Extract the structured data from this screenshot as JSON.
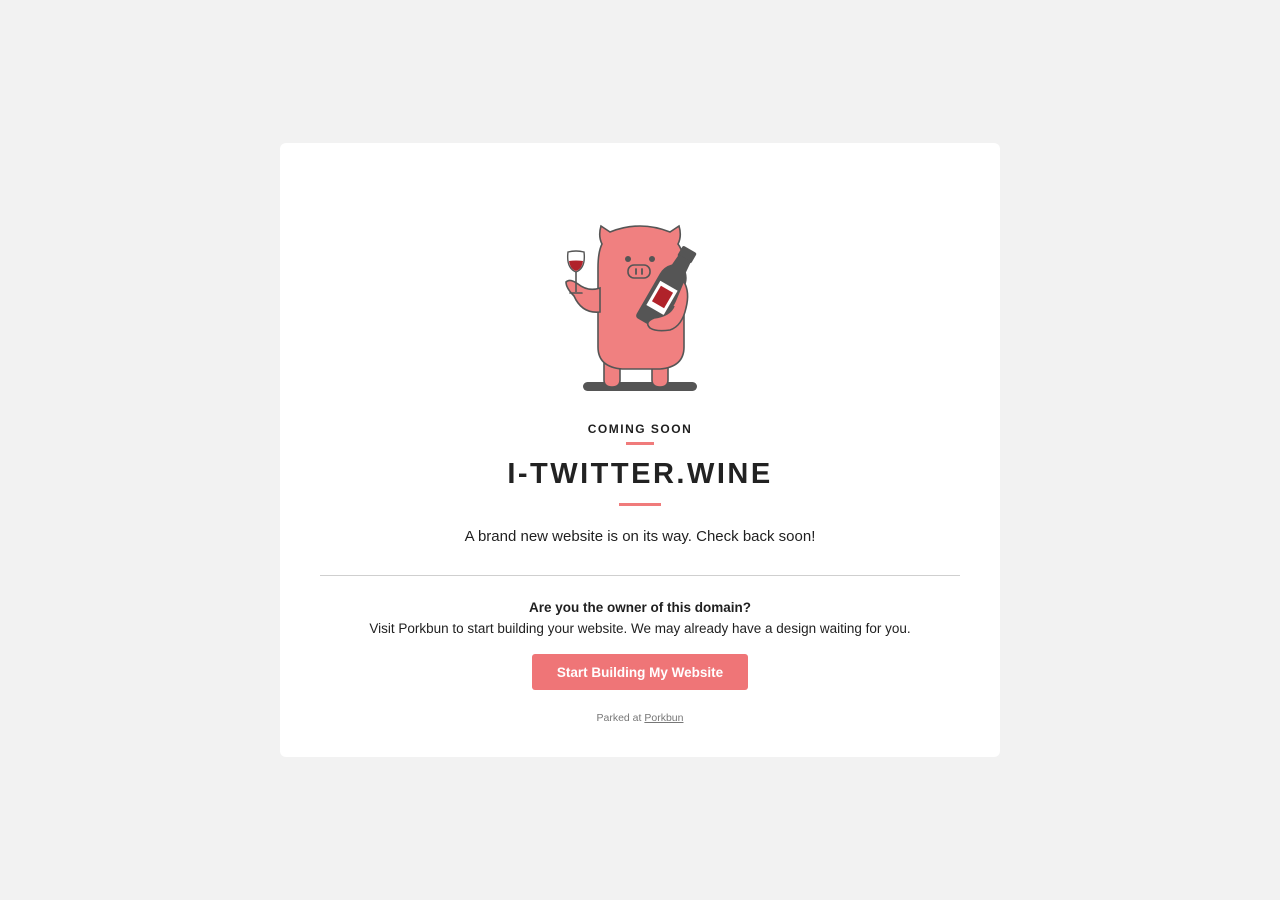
{
  "page": {
    "eyebrow": "COMING SOON",
    "domain": "I-TWITTER.WINE",
    "tagline": "A brand new website is on its way. Check back soon!",
    "owner_question": "Are you the owner of this domain?",
    "owner_text": "Visit Porkbun to start building your website. We may already have a design waiting for you.",
    "cta_label": "Start Building My Website",
    "parked_prefix": "Parked at",
    "parked_link": "Porkbun"
  },
  "colors": {
    "background": "#f2f2f2",
    "card": "#ffffff",
    "accent": "#ef7577",
    "pig": "#f08080",
    "outline": "#555555"
  },
  "illustration": {
    "icon": "pig-with-wine-icon"
  }
}
